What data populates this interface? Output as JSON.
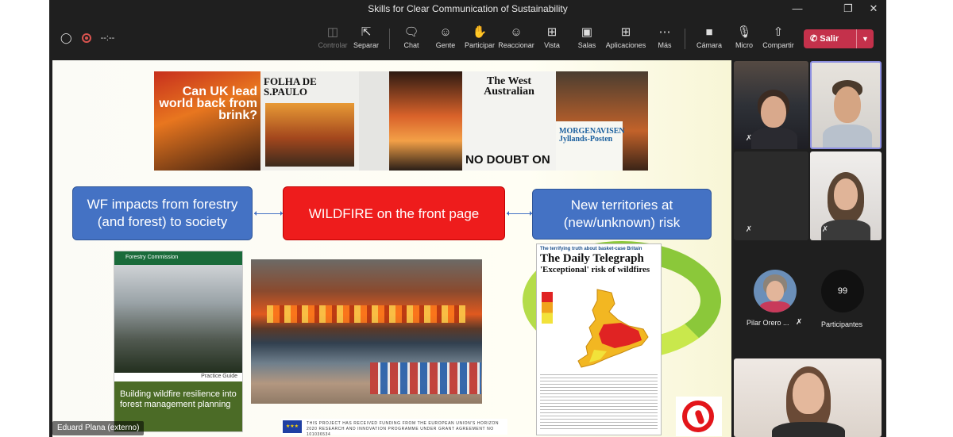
{
  "window": {
    "title": "Skills for Clear Communication of Sustainability"
  },
  "toolbar": {
    "timer": "--:--",
    "buttons": [
      {
        "label": "Controlar",
        "icon": "share-screen-icon"
      },
      {
        "label": "Separar",
        "icon": "popout-icon"
      },
      {
        "label": "Chat",
        "icon": "chat-icon"
      },
      {
        "label": "Gente",
        "icon": "people-icon"
      },
      {
        "label": "Participar",
        "icon": "raise-hand-icon"
      },
      {
        "label": "Reaccionar",
        "icon": "reaction-icon"
      },
      {
        "label": "Vista",
        "icon": "view-grid-icon"
      },
      {
        "label": "Salas",
        "icon": "rooms-icon"
      },
      {
        "label": "Aplicaciones",
        "icon": "apps-plus-icon"
      },
      {
        "label": "Más",
        "icon": "more-icon"
      },
      {
        "label": "Cámara",
        "icon": "camera-icon"
      },
      {
        "label": "Micro",
        "icon": "mic-muted-icon"
      },
      {
        "label": "Compartir",
        "icon": "share-up-icon"
      }
    ],
    "leave_label": "Salir"
  },
  "slide": {
    "box_left": "WF impacts from forestry (and forest) to society",
    "box_center": "WILDFIRE on the front page",
    "box_right": "New territories at (new/unknown) risk",
    "newspapers": {
      "n1_headline": "Can UK lead world back from brink?",
      "n2_masthead": "FOLHA DE S.PAULO",
      "n5_masthead": "The West Australian",
      "n5_bighead": "NO DOUBT ON",
      "n6_masthead": "MORGENAVISEN Jyllands-Posten"
    },
    "guide": {
      "org": "Forestry Commission",
      "type": "Practice Guide",
      "title": "Building wildfire resilience into forest management planning"
    },
    "telegraph": {
      "tagline": "The terrifying truth about basket-case Britain",
      "masthead": "The Daily Telegraph",
      "headline": "'Exceptional' risk of wildfires"
    },
    "eu_text": "THIS PROJECT HAS RECEIVED FUNDING FROM THE EUROPEAN UNION'S HORIZON 2020 RESEARCH AND INNOVATION PROGRAMME UNDER GRANT AGREEMENT NO 101036534"
  },
  "presenter": {
    "name": "Eduard Plana (externo)"
  },
  "participants": {
    "pilar_name": "Pilar Orero ...",
    "count": "99",
    "count_label": "Participantes"
  },
  "colors": {
    "leave": "#c4314b",
    "blue_box": "#4472c4",
    "red_box": "#ee1c1c",
    "active_border": "#8d8fe0"
  }
}
